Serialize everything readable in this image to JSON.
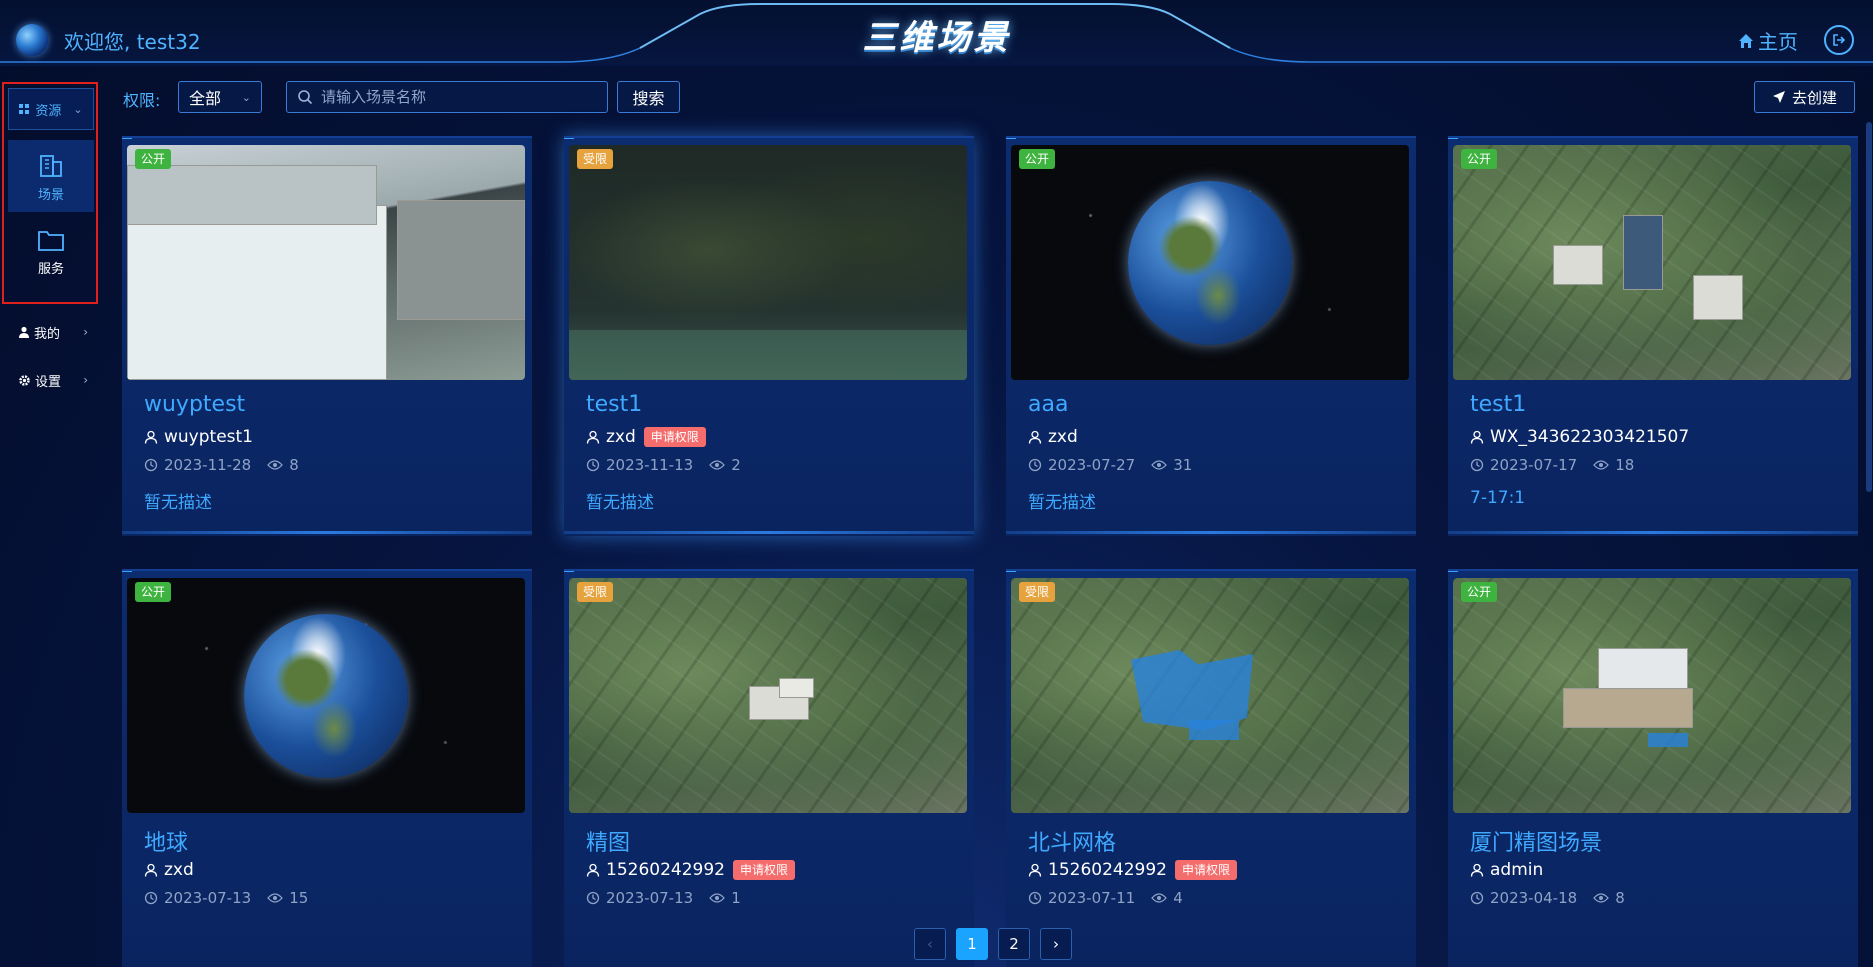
{
  "header": {
    "welcome": "欢迎您, test32",
    "title": "三维场景",
    "home_label": "主页"
  },
  "sidebar": {
    "resources_label": "资源",
    "items": [
      {
        "label": "场景",
        "icon": "building-icon",
        "active": true
      },
      {
        "label": "服务",
        "icon": "folder-icon",
        "active": false
      }
    ],
    "mine_label": "我的",
    "settings_label": "设置"
  },
  "toolbar": {
    "permission_label": "权限:",
    "permission_value": "全部",
    "search_placeholder": "请输入场景名称",
    "search_button": "搜索",
    "create_button": "去创建"
  },
  "colors": {
    "accent": "#3fa9ff",
    "public_tag": "#3fb33f",
    "limited_tag": "#e6a23c",
    "apply_badge": "#f56c6c"
  },
  "cards": [
    {
      "title": "wuyptest",
      "tag": "公开",
      "user": "wuyptest1",
      "date": "2023-11-28",
      "views": "8",
      "desc": "暂无描述",
      "thumb": "building",
      "apply": ""
    },
    {
      "title": "test1",
      "tag": "受限",
      "user": "zxd",
      "date": "2023-11-13",
      "views": "2",
      "desc": "暂无描述",
      "thumb": "map",
      "apply": "申请权限"
    },
    {
      "title": "aaa",
      "tag": "公开",
      "user": "zxd",
      "date": "2023-07-27",
      "views": "31",
      "desc": "暂无描述",
      "thumb": "globe",
      "apply": ""
    },
    {
      "title": "test1",
      "tag": "公开",
      "user": "WX_343622303421507",
      "date": "2023-07-17",
      "views": "18",
      "desc": "7-17:1",
      "thumb": "city",
      "apply": ""
    },
    {
      "title": "地球",
      "tag": "公开",
      "user": "zxd",
      "date": "2023-07-13",
      "views": "15",
      "desc": "",
      "thumb": "globe",
      "apply": ""
    },
    {
      "title": "精图",
      "tag": "受限",
      "user": "15260242992",
      "date": "2023-07-13",
      "views": "1",
      "desc": "",
      "thumb": "city",
      "apply": "申请权限"
    },
    {
      "title": "北斗网格",
      "tag": "受限",
      "user": "15260242992",
      "date": "2023-07-11",
      "views": "4",
      "desc": "",
      "thumb": "city-blue",
      "apply": "申请权限"
    },
    {
      "title": "厦门精图场景",
      "tag": "公开",
      "user": "admin",
      "date": "2023-04-18",
      "views": "8",
      "desc": "",
      "thumb": "city",
      "apply": ""
    }
  ],
  "pagination": {
    "prev": "‹",
    "pages": [
      "1",
      "2"
    ],
    "current": "1",
    "next": "›"
  }
}
